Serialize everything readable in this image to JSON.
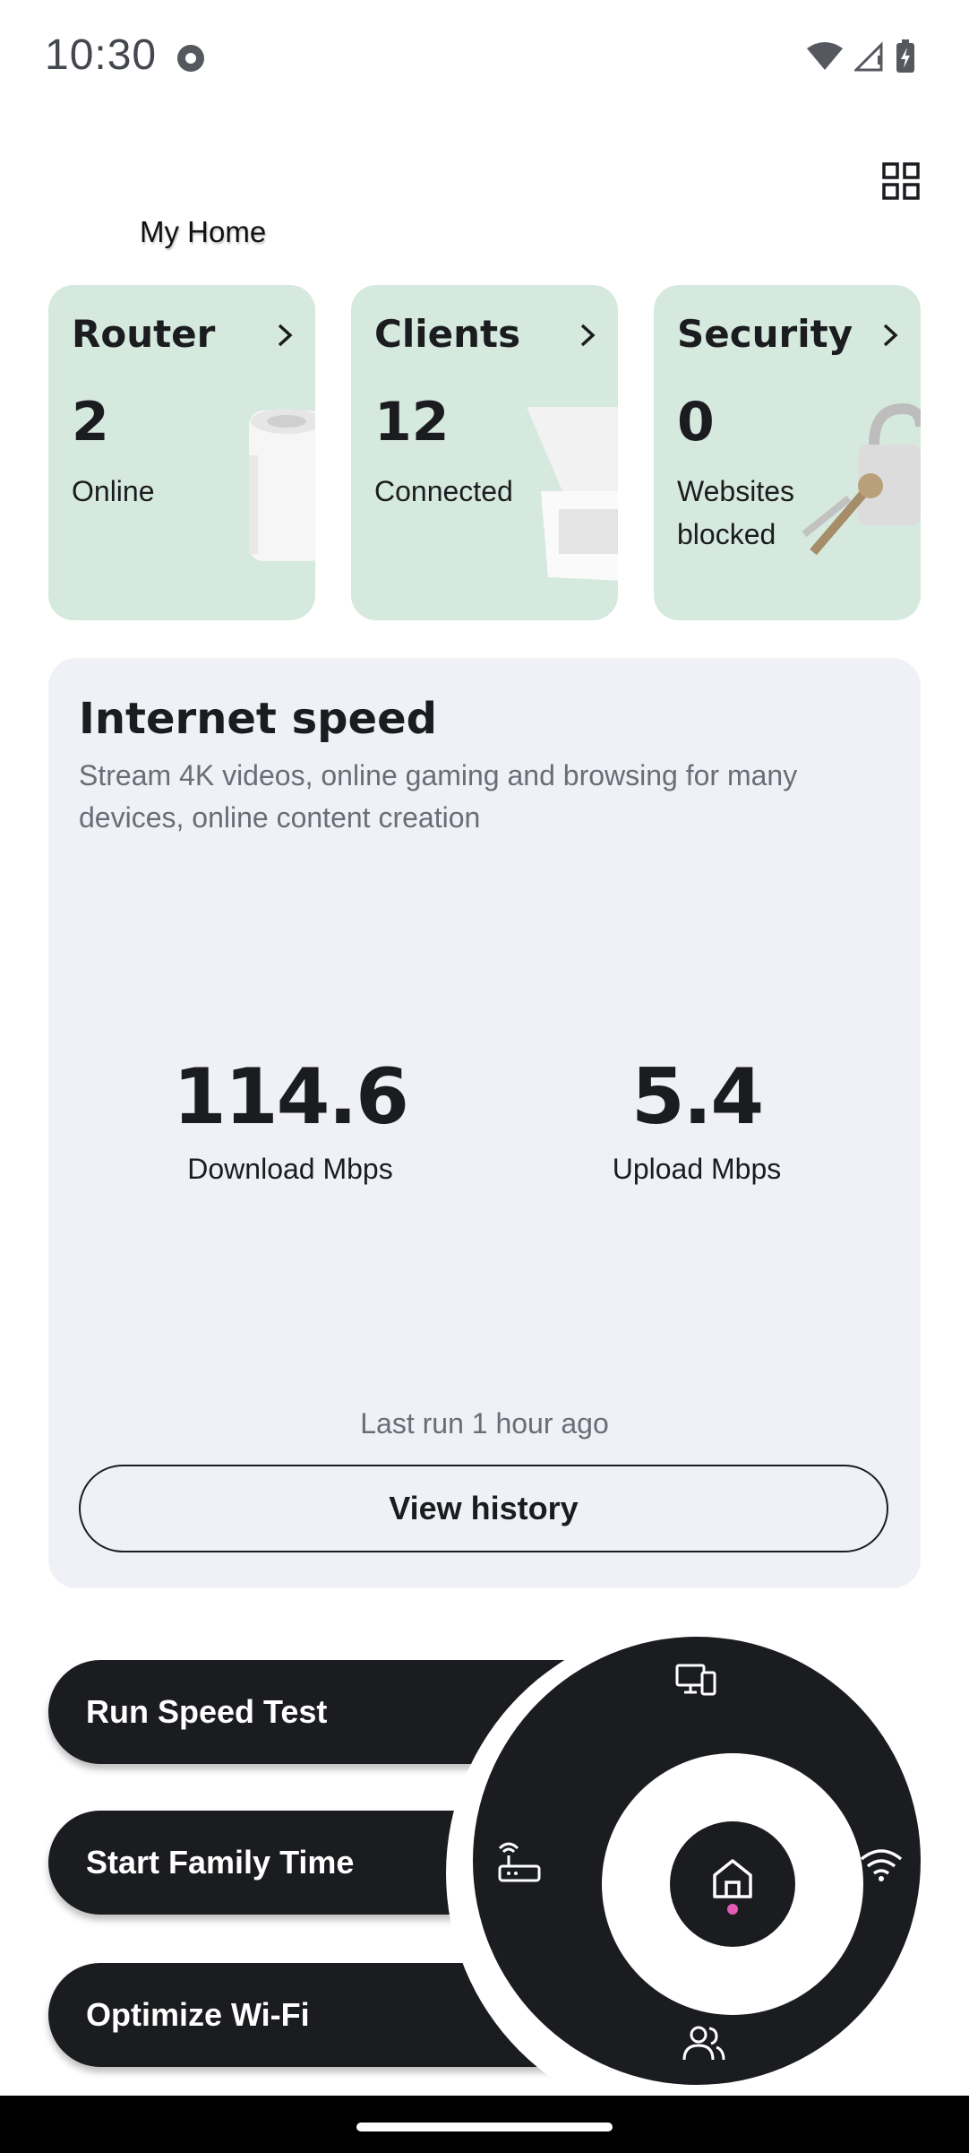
{
  "status_bar": {
    "time": "10:30"
  },
  "header": {
    "title": "My Home"
  },
  "cards": [
    {
      "title": "Router",
      "value": "2",
      "label": "Online"
    },
    {
      "title": "Clients",
      "value": "12",
      "label": "Connected"
    },
    {
      "title": "Security",
      "value": "0",
      "label": "Websites blocked"
    }
  ],
  "speed": {
    "title": "Internet speed",
    "description": "Stream 4K videos, online gaming and browsing for many devices, online content creation",
    "download_value": "114.6",
    "download_label": "Download Mbps",
    "upload_value": "5.4",
    "upload_label": "Upload Mbps",
    "last_run": "Last run 1 hour ago",
    "history_button": "View history"
  },
  "actions": {
    "speed_test": "Run Speed Test",
    "family_time": "Start Family Time",
    "optimize": "Optimize Wi-Fi"
  },
  "radial_nav": {
    "items": [
      "devices-icon",
      "router-icon",
      "wifi-icon",
      "people-icon",
      "home-icon"
    ],
    "active": "home-icon",
    "active_dot_color": "#e35bb4"
  },
  "colors": {
    "card_bg": "#d6e9de",
    "panel_bg": "#f0f1f6",
    "dark": "#1b1c20",
    "muted": "#6a6d78"
  }
}
